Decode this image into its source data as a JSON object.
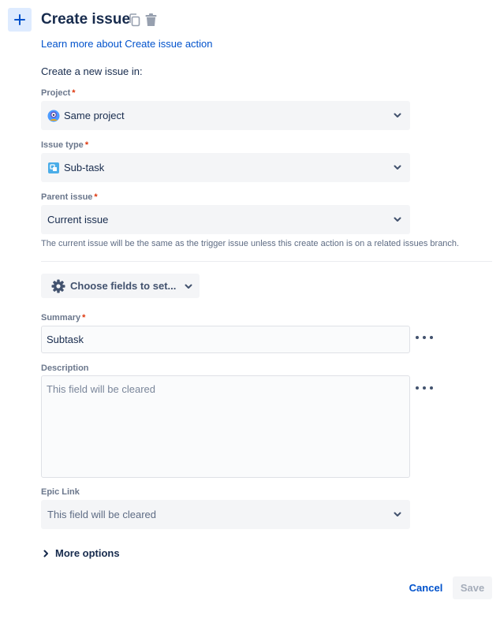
{
  "header": {
    "title": "Create issue",
    "plus_icon": "plus-icon",
    "copy_icon": "copy-icon",
    "delete_icon": "trash-icon",
    "learn_link": "Learn more about Create issue action"
  },
  "intro_text": "Create a new issue in:",
  "fields": {
    "project": {
      "label": "Project",
      "value": "Same project",
      "icon": "project-avatar-icon",
      "required": true
    },
    "issue_type": {
      "label": "Issue type",
      "value": "Sub-task",
      "icon": "subtask-icon",
      "required": true
    },
    "parent_issue": {
      "label": "Parent issue",
      "value": "Current issue",
      "required": true
    },
    "helper_text": "The current issue will be the same as the trigger issue unless this create action is on a related issues branch.",
    "choose_fields": {
      "label": "Choose fields to set...",
      "icon": "gear-icon"
    },
    "summary": {
      "label": "Summary",
      "value": "Subtask",
      "required": true
    },
    "description": {
      "label": "Description",
      "placeholder": "This field will be cleared"
    },
    "epic_link": {
      "label": "Epic Link",
      "placeholder": "This field will be cleared"
    }
  },
  "more_options": "More options",
  "footer": {
    "cancel": "Cancel",
    "save": "Save"
  },
  "colors": {
    "accent": "#0052cc",
    "required": "#de350b",
    "field_bg": "#f4f5f7",
    "plus_tile_bg": "#deebff"
  }
}
